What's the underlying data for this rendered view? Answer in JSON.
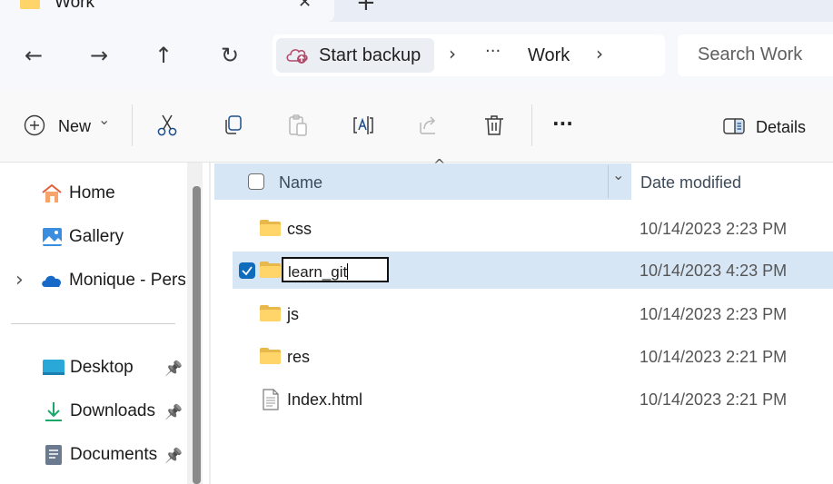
{
  "tab": {
    "title": "Work",
    "close_glyph": "✕",
    "new_glyph": "+"
  },
  "nav": {
    "back": "←",
    "forward": "→",
    "up": "↑",
    "refresh": "↻"
  },
  "address": {
    "backup_label": "Start backup",
    "chevron": "›",
    "ellipsis": "···",
    "folder": "Work"
  },
  "search": {
    "placeholder": "Search Work"
  },
  "toolbar": {
    "new_label": "New",
    "new_caret": "⌄",
    "more": "···",
    "details_label": "Details",
    "icons": [
      "plus-circle-icon",
      "cut-icon",
      "copy-icon",
      "paste-icon",
      "rename-icon",
      "share-icon",
      "delete-icon",
      "more-icon",
      "details-pane-icon"
    ]
  },
  "sidebar": {
    "items": [
      {
        "label": "Home",
        "icon": "home-icon"
      },
      {
        "label": "Gallery",
        "icon": "gallery-icon"
      },
      {
        "label": "Monique - Persc",
        "icon": "onedrive-icon",
        "expander": "›"
      },
      {
        "label": "Desktop",
        "icon": "desktop-icon",
        "pinned": true
      },
      {
        "label": "Downloads",
        "icon": "download-icon",
        "pinned": true
      },
      {
        "label": "Documents",
        "icon": "documents-icon",
        "pinned": true
      }
    ],
    "pin_glyph": "📌"
  },
  "list": {
    "columns": {
      "name": "Name",
      "date": "Date modified",
      "sort_glyph": "^",
      "filter_glyph": "⌄"
    },
    "rows": [
      {
        "name": "css",
        "date": "10/14/2023 2:23 PM",
        "type": "folder"
      },
      {
        "name": "learn_git",
        "date": "10/14/2023 4:23 PM",
        "type": "folder",
        "selected": true,
        "renaming": true
      },
      {
        "name": "js",
        "date": "10/14/2023 2:23 PM",
        "type": "folder"
      },
      {
        "name": "res",
        "date": "10/14/2023 2:21 PM",
        "type": "folder"
      },
      {
        "name": "Index.html",
        "date": "10/14/2023 2:21 PM",
        "type": "file"
      }
    ]
  },
  "colors": {
    "folder": "#ffd569",
    "selection": "#d6e6f5",
    "accent": "#0f6cbd"
  }
}
